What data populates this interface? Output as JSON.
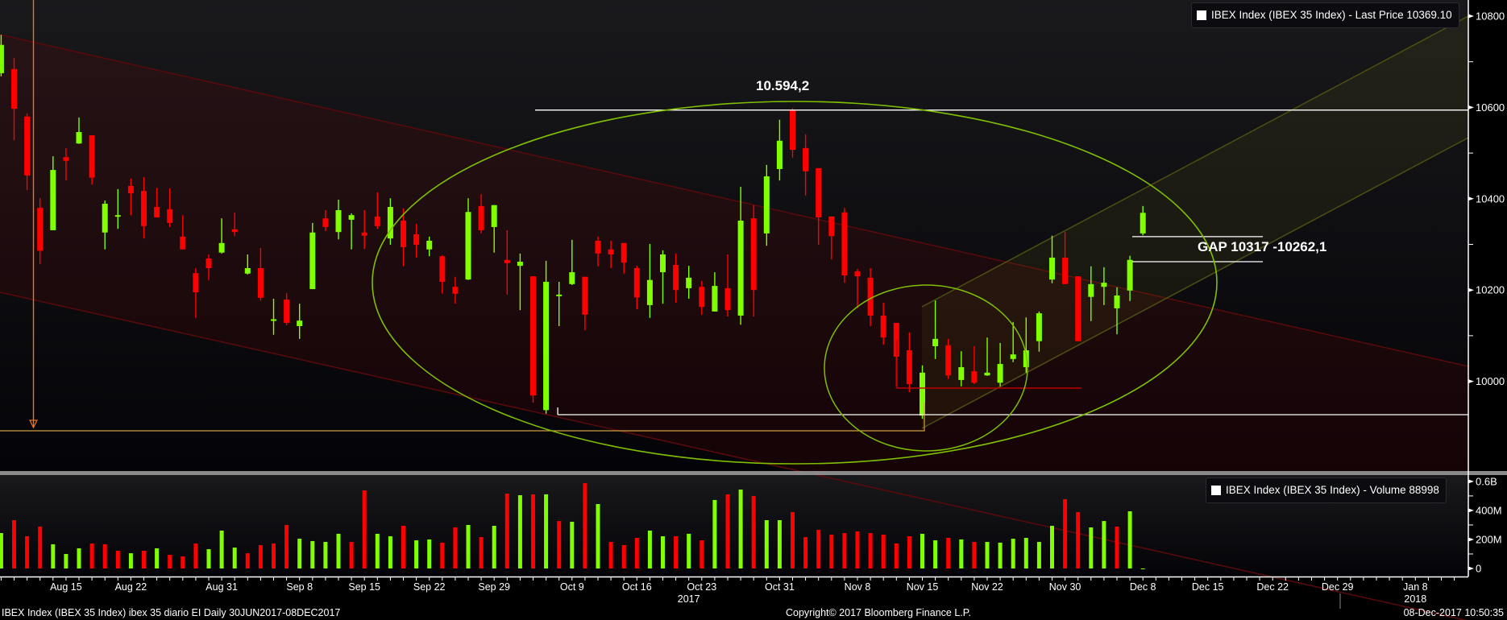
{
  "price_legend": {
    "label": "IBEX Index (IBEX 35 Index) - Last Price 10369.10"
  },
  "volume_legend": {
    "label": "IBEX Index (IBEX 35 Index) - Volume 88998"
  },
  "annotations": {
    "high_label": "10.594,2",
    "gap_label": "GAP 10317 -10262,1"
  },
  "footer": {
    "left": "IBEX Index (IBEX 35 Index) ibex 35 diario EI  Daily 30JUN2017-08DEC2017",
    "center": "Copyright© 2017 Bloomberg Finance L.P.",
    "right": "08-Dec-2017 10:50:35"
  },
  "colors": {
    "up": "#80ff00",
    "down": "#ff0000",
    "background": "#000000",
    "text": "#ffffff"
  },
  "chart_data": {
    "type": "candlestick",
    "price_axis": {
      "ticks": [
        "10000",
        "10200",
        "10400",
        "10600",
        "10800"
      ],
      "values": [
        10000,
        10200,
        10400,
        10600,
        10800
      ],
      "ylim": [
        9805,
        10835
      ]
    },
    "volume_axis": {
      "ticks": [
        "0",
        "200M",
        "400M",
        "0.6B"
      ],
      "values": [
        0,
        200,
        400,
        600
      ],
      "unit": "M"
    },
    "x_ticks": [
      {
        "label": "Aug 15",
        "date": "2017-08-15"
      },
      {
        "label": "Aug 22",
        "date": "2017-08-22"
      },
      {
        "label": "Aug 31",
        "date": "2017-08-31"
      },
      {
        "label": "Sep 8",
        "date": "2017-09-08"
      },
      {
        "label": "Sep 15",
        "date": "2017-09-15"
      },
      {
        "label": "Sep 22",
        "date": "2017-09-22"
      },
      {
        "label": "Sep 29",
        "date": "2017-09-29"
      },
      {
        "label": "Oct 9",
        "date": "2017-10-09"
      },
      {
        "label": "Oct 16",
        "date": "2017-10-16"
      },
      {
        "label": "Oct 23",
        "date": "2017-10-23"
      },
      {
        "label": "Oct 31",
        "date": "2017-10-31"
      },
      {
        "label": "Nov 8",
        "date": "2017-11-08"
      },
      {
        "label": "Nov 15",
        "date": "2017-11-15"
      },
      {
        "label": "Nov 22",
        "date": "2017-11-22"
      },
      {
        "label": "Nov 30",
        "date": "2017-11-30"
      },
      {
        "label": "Dec 8",
        "date": "2017-12-08"
      },
      {
        "label": "Dec 15",
        "date": "2017-12-15"
      },
      {
        "label": "Dec 22",
        "date": "2017-12-22"
      },
      {
        "label": "Dec 29",
        "date": "2017-12-29"
      },
      {
        "label": "Jan 8",
        "date": "2018-01-08"
      }
    ],
    "year_labels": [
      {
        "label": "2017",
        "date": "2017-10-20"
      },
      {
        "label": "2018",
        "date": "2018-01-08"
      }
    ],
    "dates": [
      "2017-08-08",
      "2017-08-09",
      "2017-08-10",
      "2017-08-11",
      "2017-08-14",
      "2017-08-15",
      "2017-08-16",
      "2017-08-17",
      "2017-08-18",
      "2017-08-21",
      "2017-08-22",
      "2017-08-23",
      "2017-08-24",
      "2017-08-25",
      "2017-08-28",
      "2017-08-29",
      "2017-08-30",
      "2017-08-31",
      "2017-09-01",
      "2017-09-04",
      "2017-09-05",
      "2017-09-06",
      "2017-09-07",
      "2017-09-08",
      "2017-09-11",
      "2017-09-12",
      "2017-09-13",
      "2017-09-14",
      "2017-09-15",
      "2017-09-18",
      "2017-09-19",
      "2017-09-20",
      "2017-09-21",
      "2017-09-22",
      "2017-09-25",
      "2017-09-26",
      "2017-09-27",
      "2017-09-28",
      "2017-09-29",
      "2017-10-02",
      "2017-10-03",
      "2017-10-04",
      "2017-10-05",
      "2017-10-06",
      "2017-10-09",
      "2017-10-10",
      "2017-10-11",
      "2017-10-12",
      "2017-10-13",
      "2017-10-16",
      "2017-10-17",
      "2017-10-18",
      "2017-10-19",
      "2017-10-20",
      "2017-10-23",
      "2017-10-24",
      "2017-10-25",
      "2017-10-26",
      "2017-10-27",
      "2017-10-30",
      "2017-10-31",
      "2017-11-01",
      "2017-11-02",
      "2017-11-03",
      "2017-11-06",
      "2017-11-07",
      "2017-11-08",
      "2017-11-09",
      "2017-11-10",
      "2017-11-13",
      "2017-11-14",
      "2017-11-15",
      "2017-11-16",
      "2017-11-17",
      "2017-11-20",
      "2017-11-21",
      "2017-11-22",
      "2017-11-23",
      "2017-11-24",
      "2017-11-27",
      "2017-11-28",
      "2017-11-29",
      "2017-11-30",
      "2017-12-01",
      "2017-12-04",
      "2017-12-05",
      "2017-12-06",
      "2017-12-07",
      "2017-12-08"
    ],
    "open": [
      10675,
      10684,
      10580,
      10380,
      10331,
      10491,
      10521,
      10539,
      10326,
      10362,
      10428,
      10417,
      10382,
      10377,
      10317,
      10237,
      10269,
      10282,
      10333,
      10236,
      10248,
      10134,
      10179,
      10121,
      10202,
      10357,
      10327,
      10354,
      10326,
      10361,
      10313,
      10352,
      10322,
      10289,
      10274,
      10207,
      10223,
      10384,
      10338,
      10266,
      10253,
      10230,
      9937,
      10189,
      10213,
      10229,
      10308,
      10289,
      10303,
      10248,
      10167,
      10239,
      10255,
      10204,
      10207,
      10153,
      10204,
      10144,
      10357,
      10324,
      10465,
      10594,
      10511,
      10467,
      10361,
      10370,
      10241,
      10227,
      10144,
      10128,
      10068,
      9925,
      10077,
      10079,
      10003,
      10022,
      10013,
      9997,
      10049,
      10031,
      10088,
      10223,
      10271,
      10230,
      10185,
      10207,
      10160,
      10199,
      10324
    ],
    "high": [
      10759,
      10708,
      10587,
      10401,
      10493,
      10511,
      10578,
      10539,
      10396,
      10421,
      10444,
      10447,
      10424,
      10423,
      10364,
      10248,
      10278,
      10357,
      10370,
      10278,
      10292,
      10181,
      10193,
      10170,
      10347,
      10375,
      10398,
      10368,
      10375,
      10414,
      10401,
      10379,
      10345,
      10317,
      10276,
      10229,
      10401,
      10410,
      10386,
      10331,
      10280,
      10230,
      10264,
      10218,
      10310,
      10229,
      10317,
      10308,
      10303,
      10253,
      10301,
      10287,
      10280,
      10253,
      10220,
      10239,
      10278,
      10426,
      10386,
      10474,
      10573,
      10598,
      10541,
      10467,
      10361,
      10380,
      10246,
      10248,
      10172,
      10128,
      10107,
      10035,
      10177,
      10093,
      10066,
      10077,
      10096,
      10084,
      10130,
      10140,
      10153,
      10319,
      10327,
      10230,
      10252,
      10250,
      10206,
      10275,
      10384
    ],
    "low": [
      10668,
      10528,
      10419,
      10257,
      10331,
      10440,
      10520,
      10431,
      10289,
      10334,
      10364,
      10313,
      10359,
      10338,
      10289,
      10139,
      10222,
      10280,
      10318,
      10234,
      10177,
      10102,
      10123,
      10093,
      10202,
      10329,
      10311,
      10289,
      10290,
      10334,
      10299,
      10252,
      10271,
      10274,
      10192,
      10170,
      10222,
      10324,
      10282,
      10190,
      10156,
      9953,
      9929,
      10121,
      10211,
      10112,
      10252,
      10248,
      10236,
      10158,
      10139,
      10170,
      10172,
      10181,
      10146,
      10153,
      10142,
      10124,
      10142,
      10297,
      10440,
      10490,
      10407,
      10299,
      10267,
      10216,
      10160,
      10121,
      10080,
      9989,
      9976,
      9918,
      10049,
      10005,
      9989,
      9994,
      10012,
      9989,
      10042,
      10019,
      10065,
      10215,
      10213,
      10088,
      10132,
      10167,
      10103,
      10176,
      10320
    ],
    "close": [
      10737,
      10597,
      10451,
      10286,
      10463,
      10483,
      10546,
      10446,
      10389,
      10364,
      10412,
      10340,
      10359,
      10347,
      10289,
      10195,
      10248,
      10303,
      10327,
      10248,
      10183,
      10136,
      10128,
      10133,
      10326,
      10338,
      10375,
      10364,
      10319,
      10340,
      10382,
      10294,
      10299,
      10308,
      10218,
      10192,
      10371,
      10331,
      10386,
      10259,
      10262,
      9969,
      10218,
      10190,
      10239,
      10146,
      10280,
      10278,
      10260,
      10184,
      10222,
      10278,
      10200,
      10227,
      10163,
      10209,
      10156,
      10352,
      10200,
      10449,
      10527,
      10507,
      10460,
      10359,
      10318,
      10232,
      10230,
      10144,
      10096,
      10054,
      9994,
      10019,
      10093,
      10013,
      10031,
      9997,
      10019,
      10038,
      10059,
      10068,
      10149,
      10271,
      10213,
      10088,
      10213,
      10216,
      10188,
      10266,
      10369.1
    ],
    "volume_m": [
      244,
      333,
      222,
      289,
      167,
      100,
      139,
      172,
      167,
      122,
      105,
      122,
      139,
      94,
      83,
      172,
      133,
      261,
      144,
      105,
      161,
      172,
      300,
      205,
      189,
      183,
      239,
      183,
      538,
      239,
      222,
      294,
      194,
      200,
      178,
      283,
      300,
      216,
      294,
      516,
      505,
      511,
      511,
      327,
      322,
      588,
      444,
      183,
      161,
      211,
      261,
      222,
      222,
      239,
      194,
      472,
      511,
      544,
      500,
      333,
      333,
      389,
      216,
      266,
      233,
      244,
      255,
      244,
      233,
      172,
      222,
      239,
      194,
      211,
      200,
      183,
      183,
      178,
      205,
      211,
      183,
      294,
      477,
      389,
      283,
      327,
      289,
      394,
      0.089
    ],
    "volume_up": [
      1,
      0,
      0,
      0,
      1,
      1,
      1,
      0,
      0,
      0,
      1,
      0,
      1,
      0,
      0,
      0,
      1,
      1,
      1,
      0,
      0,
      0,
      0,
      1,
      1,
      1,
      1,
      0,
      0,
      1,
      1,
      0,
      1,
      1,
      0,
      0,
      1,
      0,
      1,
      0,
      1,
      0,
      1,
      0,
      1,
      0,
      1,
      0,
      0,
      0,
      1,
      1,
      0,
      1,
      0,
      1,
      0,
      1,
      0,
      1,
      1,
      0,
      0,
      0,
      0,
      0,
      0,
      0,
      0,
      0,
      0,
      1,
      1,
      0,
      1,
      0,
      1,
      1,
      1,
      1,
      1,
      1,
      0,
      0,
      1,
      1,
      0,
      1,
      1
    ],
    "levels": {
      "high": 10594.2,
      "gap_top": 10317,
      "gap_bottom": 10262.1
    }
  }
}
